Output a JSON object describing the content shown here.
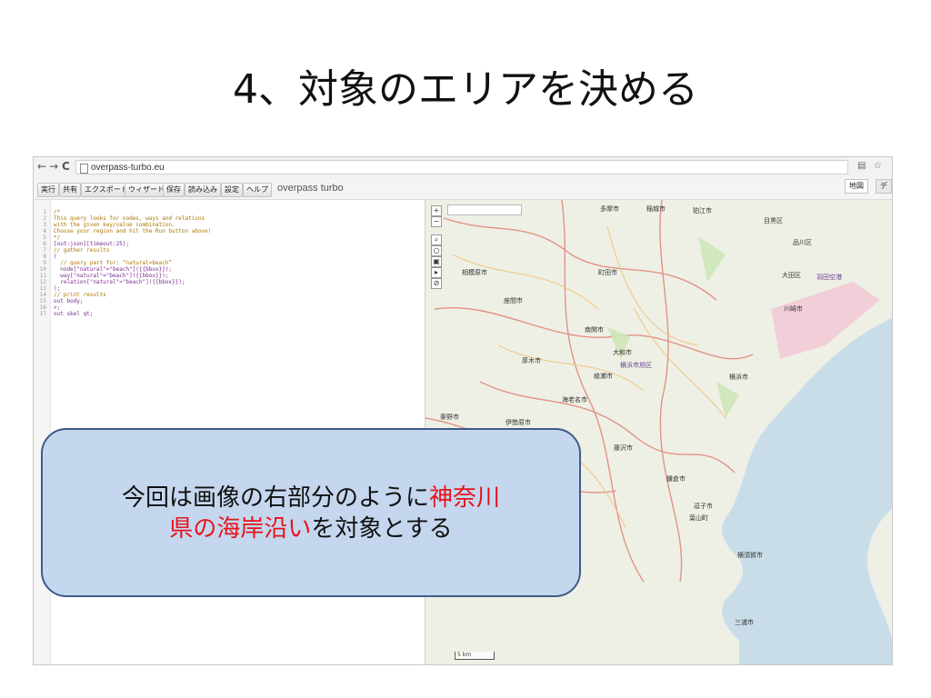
{
  "slide": {
    "title": "4、対象のエリアを決める"
  },
  "browser": {
    "back": "←",
    "forward": "→",
    "reload": "C",
    "url": "overpass-turbo.eu"
  },
  "toolbar": {
    "buttons": [
      "実行",
      "共有",
      "エクスポート",
      "ウィザード",
      "保存",
      "読み込み",
      "設定",
      "ヘルプ"
    ],
    "brand": "overpass turbo",
    "map_tabs": [
      "地図",
      "デ"
    ]
  },
  "editor": {
    "line_numbers": [
      "1",
      "2",
      "3",
      "4",
      "5",
      "6",
      "7",
      "8",
      "9",
      "10",
      "11",
      "12",
      "13",
      "14",
      "15",
      "16",
      "17"
    ],
    "lines": [
      "/*",
      "This query looks for nodes, ways and relations",
      "with the given key/value combination.",
      "Choose your region and hit the Run button above!",
      "*/",
      "[out:json][timeout:25];",
      "// gather results",
      "(",
      "  // query part for: “natural=beach”",
      "  node[\"natural\"=\"beach\"]({{bbox}});",
      "  way[\"natural\"=\"beach\"]({{bbox}});",
      "  relation[\"natural\"=\"beach\"]({{bbox}});",
      ");",
      "// print results",
      "out body;",
      ">;",
      "out skel qt;"
    ]
  },
  "map": {
    "controls": [
      "+",
      "−",
      "⌕",
      "○",
      "▣",
      "▸",
      "⊘"
    ],
    "labels": [
      "多摩市",
      "稲城市",
      "狛江市",
      "目黒区",
      "品川区",
      "相模原市",
      "町田市",
      "大田区",
      "羽田空港",
      "川崎市",
      "座間市",
      "南関市",
      "大和市",
      "厚木市",
      "横浜市",
      "海老名市",
      "綾瀬市",
      "秦野市",
      "伊勢原市",
      "藤沢市",
      "鎌倉市",
      "逗子市",
      "葉山町",
      "横須賀市",
      "三浦市",
      "横浜市旭区"
    ],
    "scale": "5 km"
  },
  "callout": {
    "line1_black": "今回は画像の右部分のように",
    "line1_red": "神奈川",
    "line2_red": "県の海岸沿い",
    "line2_black": "を対象とする"
  },
  "colors": {
    "callout_fill": "#c5d7ee",
    "callout_border": "#3f5b86",
    "highlight": "#e5141b",
    "sea": "#c9dde9",
    "land": "#eef0e6"
  }
}
